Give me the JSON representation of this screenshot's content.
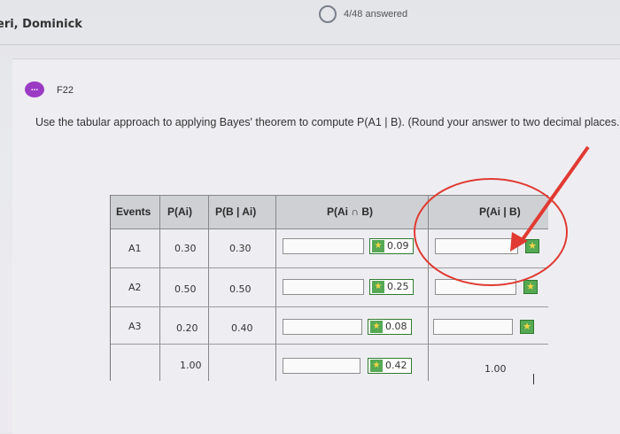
{
  "header": {
    "user_name": "eri, Dominick",
    "answered": "4/48 answered"
  },
  "question": {
    "badge": "...",
    "id": "F22",
    "prompt": "Use the tabular approach to applying Bayes' theorem to compute P(A1 | B). (Round your answer to two decimal places.)"
  },
  "table": {
    "headers": {
      "events": "Events",
      "prior": "P(Ai)",
      "conditional": "P(B | Ai)",
      "joint": "P(Ai ∩ B)",
      "posterior": "P(Ai | B)"
    },
    "rows": [
      {
        "event": "A1",
        "prior": "0.30",
        "conditional": "0.30",
        "joint_key": "0.09",
        "posterior_key": ""
      },
      {
        "event": "A2",
        "prior": "0.50",
        "conditional": "0.50",
        "joint_key": "0.25",
        "posterior_key": ""
      },
      {
        "event": "A3",
        "prior": "0.20",
        "conditional": "0.40",
        "joint_key": "0.08",
        "posterior_key": ""
      }
    ],
    "totals": {
      "prior": "1.00",
      "joint_key": "0.42",
      "posterior": "1.00"
    }
  },
  "icons": {
    "key": "key-icon"
  },
  "colors": {
    "badge": "#9b3bc4",
    "key_green": "#55a955",
    "annotation_red": "#e03a32"
  }
}
